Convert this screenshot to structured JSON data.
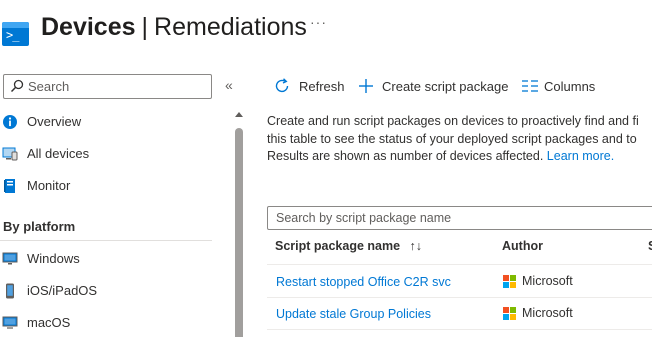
{
  "header": {
    "title_main": "Devices",
    "title_separator": "|",
    "title_sub": "Remediations",
    "more_label": "···"
  },
  "sidebar": {
    "search_placeholder": "Search",
    "collapse_label": "«",
    "items": [
      {
        "label": "Overview",
        "icon": "info-icon"
      },
      {
        "label": "All devices",
        "icon": "devices-icon"
      },
      {
        "label": "Monitor",
        "icon": "monitor-book-icon"
      }
    ],
    "section_title": "By platform",
    "platform_items": [
      {
        "label": "Windows",
        "icon": "windows-monitor-icon"
      },
      {
        "label": "iOS/iPadOS",
        "icon": "phone-icon"
      },
      {
        "label": "macOS",
        "icon": "mac-monitor-icon"
      }
    ]
  },
  "toolbar": {
    "refresh_label": "Refresh",
    "create_label": "Create script package",
    "columns_label": "Columns"
  },
  "description": {
    "line1": "Create and run script packages on devices to proactively find and fi",
    "line2": "this table to see the status of your deployed script packages and to",
    "line3": "Results are shown as number of devices affected.",
    "link": "Learn more."
  },
  "table": {
    "search_placeholder": "Search by script package name",
    "columns": {
      "name": "Script package name",
      "sort_icon": "↑↓",
      "author": "Author",
      "third": "S"
    },
    "rows": [
      {
        "name": "Restart stopped Office C2R svc",
        "author": "Microsoft"
      },
      {
        "name": "Update stale Group Policies",
        "author": "Microsoft"
      }
    ]
  },
  "colors": {
    "accent": "#0078d4",
    "ms_red": "#f25022",
    "ms_green": "#7fba00",
    "ms_blue": "#00a4ef",
    "ms_yellow": "#ffb900"
  }
}
